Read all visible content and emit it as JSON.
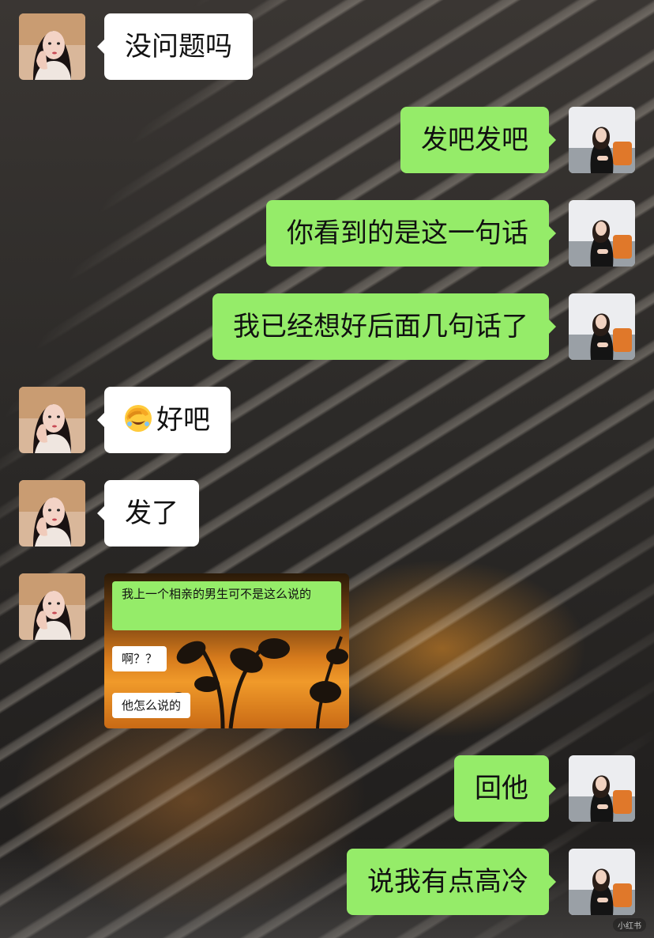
{
  "messages": [
    {
      "side": "in",
      "text": "没问题吗"
    },
    {
      "side": "out",
      "text": "发吧发吧"
    },
    {
      "side": "out",
      "text": "你看到的是这一句话"
    },
    {
      "side": "out",
      "text": "我已经想好后面几句话了"
    },
    {
      "side": "in",
      "emoji": "face-with-hand-over-eyes-emoji",
      "text": "好吧"
    },
    {
      "side": "in",
      "text": "发了"
    },
    {
      "side": "in",
      "type": "image",
      "screenshot": {
        "line1": "我上一个相亲的男生可不是这么说的",
        "line2": "啊？？",
        "line3": "他怎么说的"
      }
    },
    {
      "side": "out",
      "text": "回他"
    },
    {
      "side": "out",
      "text": "说我有点高冷"
    }
  ],
  "watermark": "小红书",
  "colors": {
    "out_bubble": "#95ec69",
    "in_bubble": "#ffffff"
  }
}
